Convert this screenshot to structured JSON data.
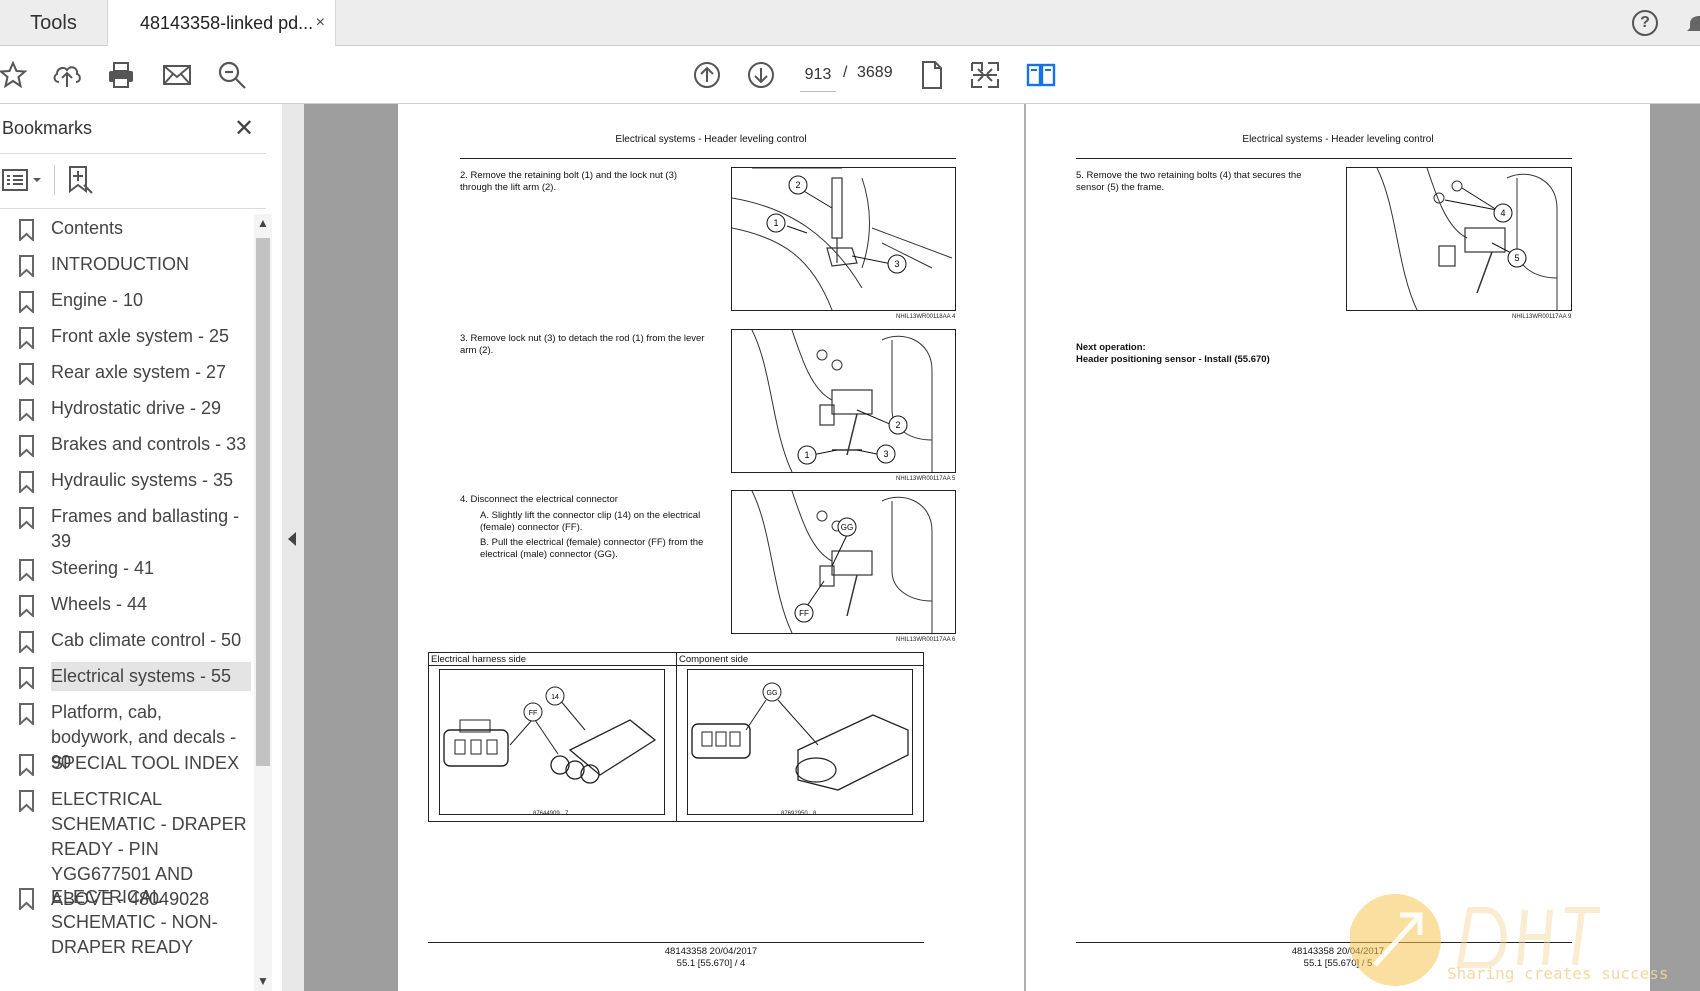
{
  "tabs": {
    "tools_label": "Tools",
    "doc_label": "48143358-linked pd...",
    "close_glyph": "×",
    "help_glyph": "?"
  },
  "toolbar": {
    "current_page": "913",
    "page_separator": "/",
    "total_pages": "3689"
  },
  "bookmarks": {
    "title": "Bookmarks",
    "close_glyph": "✕",
    "items": [
      {
        "label": "Contents"
      },
      {
        "label": "INTRODUCTION"
      },
      {
        "label": "Engine - 10"
      },
      {
        "label": "Front axle system - 25"
      },
      {
        "label": "Rear axle system - 27"
      },
      {
        "label": "Hydrostatic drive - 29"
      },
      {
        "label": "Brakes and controls - 33"
      },
      {
        "label": "Hydraulic systems - 35"
      },
      {
        "label": "Frames and ballasting - 39"
      },
      {
        "label": "Steering - 41"
      },
      {
        "label": "Wheels - 44"
      },
      {
        "label": "Cab climate control - 50"
      },
      {
        "label": "Electrical systems - 55"
      },
      {
        "label": "Platform, cab, bodywork, and decals - 90"
      },
      {
        "label": "SPECIAL TOOL INDEX"
      },
      {
        "label": "ELECTRICAL SCHEMATIC - DRAPER READY - PIN YGG677501 AND ABOVE - 48049028"
      },
      {
        "label": "ELECTRICAL SCHEMATIC - NON-DRAPER READY"
      }
    ],
    "selected_index": 12
  },
  "page_left": {
    "header": "Electrical systems - Header leveling control",
    "step2": "2.   Remove the retaining bolt (1) and the lock nut (3) through the lift arm (2).",
    "step3": "3.   Remove lock nut (3) to detach the rod (1) from the lever arm (2).",
    "step4": "4.   Disconnect the electrical connector",
    "step4a": "A.   Slightly lift the connector clip (14) on the electrical (female) connector (FF).",
    "step4b": "B.   Pull the electrical (female) connector (FF) from the electrical (male) connector (GG).",
    "fig4_code": "NHIL13WR00118AA",
    "fig4_num": "4",
    "fig5_code": "NHIL13WR00117AA",
    "fig5_num": "5",
    "fig6_code": "NHIL13WR00117AA",
    "fig6_num": "6",
    "table_left_caption": "Electrical harness side",
    "table_right_caption": "Component side",
    "fig7_code": "87644909",
    "fig7_num": "7",
    "fig8_code": "87692950",
    "fig8_num": "8",
    "footer_line1": "48143358 20/04/2017",
    "footer_line2": "55.1 [55.670] / 4",
    "callouts": {
      "c1": "1",
      "c2": "2",
      "c3": "3",
      "c14": "14",
      "cFF": "FF",
      "cGG": "GG"
    }
  },
  "page_right": {
    "header": "Electrical systems - Header leveling control",
    "step5": "5.   Remove the two retaining bolts (4) that secures the sensor (5) the frame.",
    "fig9_code": "NHIL13WR00117AA",
    "fig9_num": "9",
    "next_label": "Next operation:",
    "next_op": "Header positioning sensor - Install (55.670)",
    "footer_line1": "48143358 20/04/2017",
    "footer_line2": "55.1 [55.670] / 5",
    "callouts": {
      "c4": "4",
      "c5": "5"
    }
  },
  "watermark": {
    "text": "Sharing creates success"
  },
  "colors": {
    "accent_blue": "#1473e6",
    "gutter": "#9e9e9e",
    "selected_bookmark": "#e4e4e4"
  },
  "icons": [
    "star-icon",
    "cloud-upload-icon",
    "print-icon",
    "mail-icon",
    "zoom-search-icon",
    "page-up-icon",
    "page-down-icon",
    "single-page-icon",
    "fit-page-icon",
    "two-page-icon",
    "help-icon",
    "bell-icon",
    "bookmark-options-icon",
    "bookmark-add-icon",
    "bookmark-flag-icon"
  ]
}
